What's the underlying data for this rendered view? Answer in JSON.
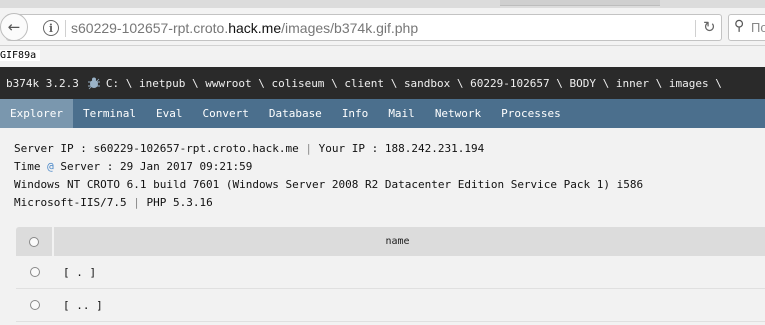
{
  "browser": {
    "url_host_prefix": "s60229-102657-rpt.croto.",
    "url_domain": "hack.me",
    "url_path": "/images/b374k.gif.php",
    "search_placeholder": "По"
  },
  "page": {
    "gif_header": "GIF89a",
    "shell": {
      "name": "b374k 3.2.3",
      "path": [
        "C:",
        "\\",
        "inetpub",
        "\\",
        "wwwroot",
        "\\",
        "coliseum",
        "\\",
        "client",
        "\\",
        "sandbox",
        "\\",
        "60229-102657",
        "\\",
        "BODY",
        "\\",
        "inner",
        "\\",
        "images",
        "\\"
      ]
    },
    "menu": [
      "Explorer",
      "Terminal",
      "Eval",
      "Convert",
      "Database",
      "Info",
      "Mail",
      "Network",
      "Processes"
    ],
    "info": {
      "server_ip_label": "Server IP : s60229-102657-rpt.croto.hack.me",
      "separator": "|",
      "your_ip_label": "Your IP : 188.242.231.194",
      "time_label": "Time",
      "at": "@",
      "server_time": "Server : 29 Jan 2017 09:21:59",
      "os_line": "Windows NT CROTO 6.1 build 7601 (Windows Server 2008 R2 Datacenter Edition Service Pack 1) i586",
      "iis": "Microsoft-IIS/7.5",
      "php": "PHP 5.3.16"
    },
    "table": {
      "header": "name",
      "rows": [
        "[ . ]",
        "[ .. ]"
      ]
    }
  }
}
